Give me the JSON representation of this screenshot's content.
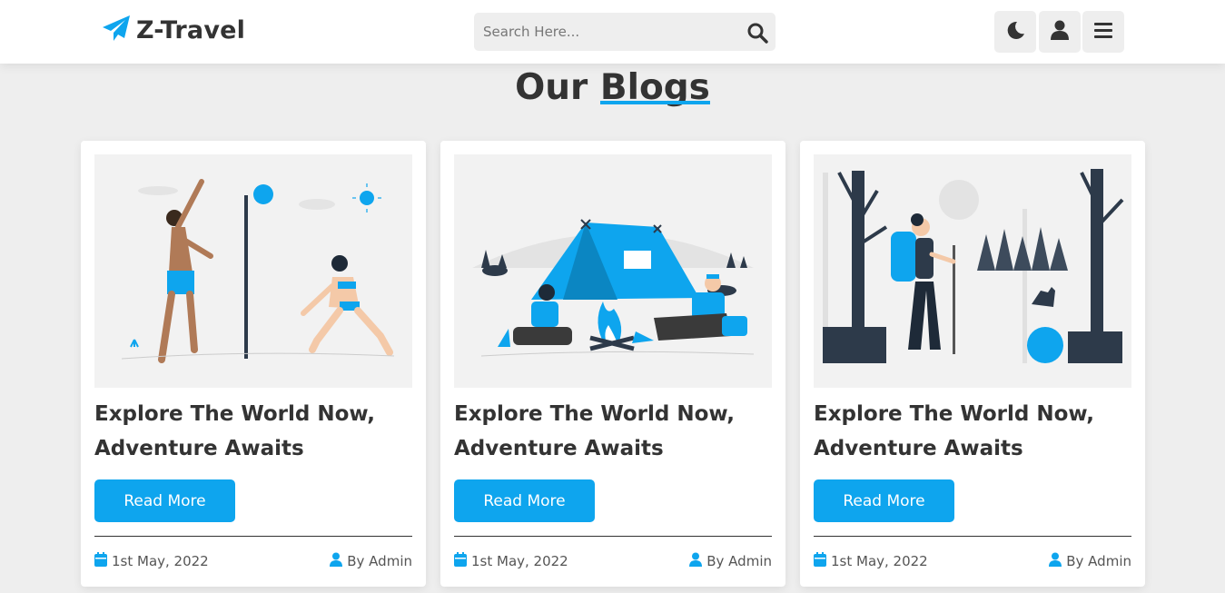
{
  "header": {
    "brand": "Z-Travel",
    "search_placeholder": "Search Here...",
    "icons": [
      "paper-plane-icon",
      "search-icon",
      "moon-icon",
      "user-icon",
      "bars-icon"
    ]
  },
  "section": {
    "title_part1": "Our ",
    "title_part2": "Blogs"
  },
  "posts": [
    {
      "illustration": "beach-volleyball-illustration",
      "title": "Explore The World Now, Adventure Awaits",
      "button": "Read More",
      "date": "1st May, 2022",
      "author": "By Admin"
    },
    {
      "illustration": "campfire-tent-illustration",
      "title": "Explore The World Now, Adventure Awaits",
      "button": "Read More",
      "date": "1st May, 2022",
      "author": "By Admin"
    },
    {
      "illustration": "forest-hiker-illustration",
      "title": "Explore The World Now, Adventure Awaits",
      "button": "Read More",
      "date": "1st May, 2022",
      "author": "By Admin"
    }
  ],
  "colors": {
    "accent": "#0ea5ee",
    "text": "#333333",
    "background": "#eeeeee",
    "card": "#ffffff"
  }
}
